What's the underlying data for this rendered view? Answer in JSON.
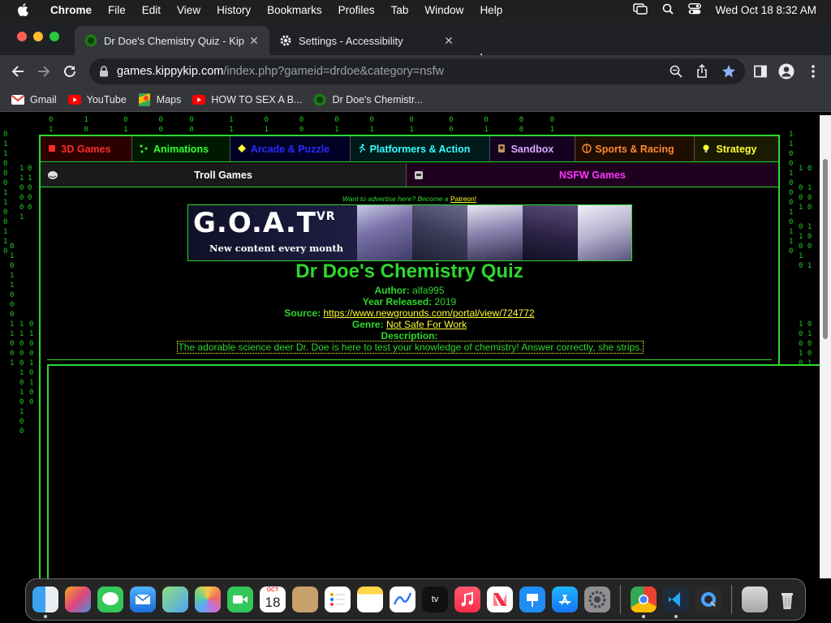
{
  "menubar": {
    "app_name": "Chrome",
    "items": [
      "File",
      "Edit",
      "View",
      "History",
      "Bookmarks",
      "Profiles",
      "Tab",
      "Window",
      "Help"
    ],
    "datetime": "Wed Oct 18  8:32 AM"
  },
  "tabs": [
    {
      "title": "Dr Doe's Chemistry Quiz - Kip",
      "active": true
    },
    {
      "title": "Settings - Accessibility",
      "active": false
    }
  ],
  "toolbar": {
    "url_host": "games.kippykip.com",
    "url_path": "/index.php?gameid=drdoe&category=nsfw"
  },
  "bookmarks": [
    {
      "label": "Gmail",
      "icon": "gmail-icon"
    },
    {
      "label": "YouTube",
      "icon": "youtube-icon"
    },
    {
      "label": "Maps",
      "icon": "maps-icon"
    },
    {
      "label": "HOW TO SEX A B...",
      "icon": "youtube-icon"
    },
    {
      "label": "Dr Doe's Chemistr...",
      "icon": "site-icon"
    }
  ],
  "categories_row1": [
    {
      "label": "3D Games",
      "color": "#ff2a2a",
      "bg": "#2a0000"
    },
    {
      "label": "Animations",
      "color": "#33ff33",
      "bg": "#001a00"
    },
    {
      "label": "Arcade & Puzzle",
      "color": "#2b2bff",
      "bg": "#000026"
    },
    {
      "label": "Platformers & Action",
      "color": "#33ffff",
      "bg": "#001a1a"
    },
    {
      "label": "Sandbox",
      "color": "#d9aaff",
      "bg": "#14001f"
    },
    {
      "label": "Sports & Racing",
      "color": "#ff8a33",
      "bg": "#1f0d00"
    },
    {
      "label": "Strategy",
      "color": "#ffff33",
      "bg": "#1a1a00"
    }
  ],
  "categories_row2": [
    {
      "label": "Troll Games",
      "color": "#ffffff",
      "bg": "#1a1a1a"
    },
    {
      "label": "NSFW Games",
      "color": "#ff33ff",
      "bg": "#1f001f"
    }
  ],
  "ad": {
    "note": "Want to advertise here? Become a",
    "link": "Patreon!",
    "banner_title": "G.O.A.T",
    "banner_sup": "VR",
    "banner_tagline": "New content every month"
  },
  "game": {
    "title": "Dr Doe's Chemistry Quiz",
    "author_label": "Author:",
    "author": "alfa995",
    "year_label": "Year Released:",
    "year": "2019",
    "source_label": "Source:",
    "source": "https://www.newgrounds.com/portal/view/724772",
    "genre_label": "Genre:",
    "genre": "Not Safe For Work",
    "description_label": "Description:",
    "description": "The adorable science deer Dr. Doe is here to test your knowledge of chemistry! Answer correctly, she strips."
  },
  "dock": {
    "calendar_month": "OCT",
    "calendar_day": "18"
  }
}
